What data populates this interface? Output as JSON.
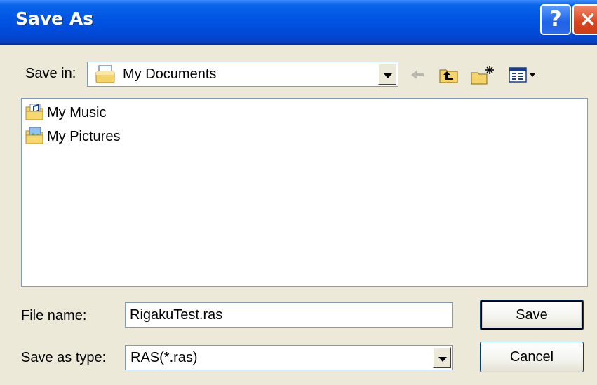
{
  "window": {
    "title": "Save As"
  },
  "titlebar": {
    "help_label": "?",
    "close_label": "×"
  },
  "toolbar": {
    "save_in_label": "Save in:",
    "save_in_value": "My Documents"
  },
  "files": [
    {
      "name": "My Music",
      "icon": "music-folder-icon"
    },
    {
      "name": "My Pictures",
      "icon": "pictures-folder-icon"
    }
  ],
  "form": {
    "file_name_label": "File name:",
    "file_name_value": "RigakuTest.ras",
    "save_as_type_label": "Save as type:",
    "save_as_type_value": "RAS(*.ras)"
  },
  "buttons": {
    "save": "Save",
    "cancel": "Cancel"
  },
  "colors": {
    "titlebar": "#0054E3",
    "dialog_bg": "#ECE9D8",
    "close": "#D9441C",
    "border": "#7F9DB9"
  }
}
